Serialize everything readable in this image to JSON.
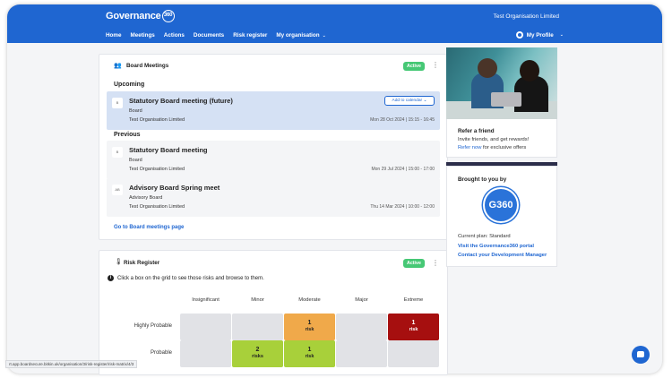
{
  "header": {
    "logo_text": "Governance",
    "logo_mark": "360",
    "org_name": "Test Organisation Limited",
    "nav": [
      "Home",
      "Meetings",
      "Actions",
      "Documents",
      "Risk register",
      "My organisation"
    ],
    "profile_label": "My Profile"
  },
  "meetings_card": {
    "title": "Board Meetings",
    "badge": "Active",
    "upcoming_heading": "Upcoming",
    "previous_heading": "Previous",
    "upcoming": [
      {
        "icon_text": "B",
        "title": "Statutory Board meeting (future)",
        "group": "Board",
        "org": "Test Organisation Limited",
        "date": "Mon 28 Oct 2024 | 15:15 - 16:45",
        "button": "Add to calendar"
      }
    ],
    "previous": [
      {
        "icon_text": "B",
        "title": "Statutory Board meeting",
        "group": "Board",
        "org": "Test Organisation Limited",
        "date": "Mon 29 Jul 2024 | 15:00 - 17:00"
      },
      {
        "icon_text": "AB",
        "title": "Advisory Board Spring meet",
        "group": "Advisory Board",
        "org": "Test Organisation Limited",
        "date": "Thu 14 Mar 2024 | 10:00 - 12:00"
      }
    ],
    "footer_link": "Go to Board meetings page"
  },
  "risk_card": {
    "title": "Risk Register",
    "badge": "Active",
    "info": "Click a box on the grid to see those risks and browse to them.",
    "columns": [
      "Insignificant",
      "Minor",
      "Moderate",
      "Major",
      "Extreme"
    ],
    "rows": [
      {
        "label": "Highly Probable",
        "cells": [
          {
            "count": "",
            "unit": "",
            "color": "#e1e2e6"
          },
          {
            "count": "",
            "unit": "",
            "color": "#e1e2e6"
          },
          {
            "count": "1",
            "unit": "risk",
            "color": "#f0a94a"
          },
          {
            "count": "",
            "unit": "",
            "color": "#e1e2e6"
          },
          {
            "count": "1",
            "unit": "risk",
            "color": "#a60f0f",
            "text_color": "#ffffff"
          }
        ]
      },
      {
        "label": "Probable",
        "cells": [
          {
            "count": "",
            "unit": "",
            "color": "#e1e2e6"
          },
          {
            "count": "2",
            "unit": "risks",
            "color": "#a8d03a"
          },
          {
            "count": "1",
            "unit": "risk",
            "color": "#a8d03a"
          },
          {
            "count": "",
            "unit": "",
            "color": "#e1e2e6"
          },
          {
            "count": "",
            "unit": "",
            "color": "#e1e2e6"
          }
        ]
      }
    ]
  },
  "refer": {
    "title": "Refer a friend",
    "text": "Invite friends, and get rewards!",
    "link": "Refer now",
    "link_suffix": " for exclusive offers"
  },
  "brought": {
    "title": "Brought to you by",
    "logo_text": "G360",
    "plan": "Current plan: Standard",
    "link1": "Visit the Governance360 portal",
    "link2": "Contact your Development Manager"
  },
  "status_url": "rt.app.boardsecure.bitkin.uk/organisation/3/risk-register/risk-matrix/4/3",
  "colors": {
    "primary": "#1f66d1",
    "active": "#46c875"
  }
}
